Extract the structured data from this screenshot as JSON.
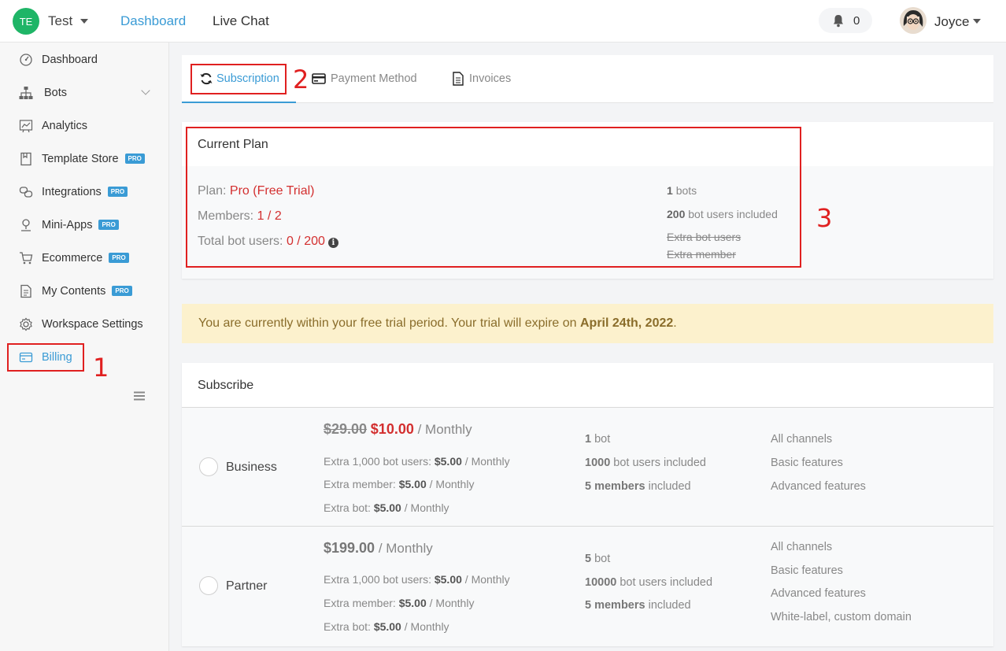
{
  "topbar": {
    "workspace_initials": "TE",
    "workspace_name": "Test",
    "nav": [
      "Dashboard",
      "Live Chat"
    ],
    "notification_count": "0",
    "user_name": "Joyce"
  },
  "sidebar": {
    "pro_badge": "PRO",
    "items": [
      {
        "label": "Dashboard"
      },
      {
        "label": "Bots"
      },
      {
        "label": "Analytics"
      },
      {
        "label": "Template Store"
      },
      {
        "label": "Integrations"
      },
      {
        "label": "Mini-Apps"
      },
      {
        "label": "Ecommerce"
      },
      {
        "label": "My Contents"
      },
      {
        "label": "Workspace Settings"
      },
      {
        "label": "Billing"
      }
    ]
  },
  "annotations": [
    "1",
    "2",
    "3"
  ],
  "tabs": [
    "Subscription",
    "Payment Method",
    "Invoices"
  ],
  "current_plan": {
    "title": "Current Plan",
    "plan_label": "Plan:",
    "plan_value": "Pro (Free Trial)",
    "members_label": "Members:",
    "members_value": "1 / 2",
    "users_label": "Total bot users:",
    "users_value": "0 / 200",
    "bots_count": "1",
    "bots_text": "bots",
    "users_included_count": "200",
    "users_included_text": "bot users included",
    "extra_bot_users": "Extra bot users",
    "extra_member": "Extra member"
  },
  "trial": {
    "text": "You are currently within your free trial period. Your trial will expire on",
    "date": "April 24th, 2022",
    "end": "."
  },
  "subscribe": {
    "title": "Subscribe",
    "plans": [
      {
        "name": "Business",
        "old_price": "$29.00",
        "new_price": "$10.00",
        "period": "/ Monthly",
        "extra_users_label": "Extra 1,000 bot users:",
        "extra_users_price": "$5.00",
        "extra_member_label": "Extra member:",
        "extra_member_price": "$5.00",
        "extra_bot_label": "Extra bot:",
        "extra_bot_price": "$5.00",
        "bots_count": "1",
        "bots_text": "bot",
        "users_count": "1000",
        "users_text": "bot users included",
        "members_count": "5 members",
        "members_text": "included",
        "features": [
          "All channels",
          "Basic features",
          "Advanced features"
        ]
      },
      {
        "name": "Partner",
        "price": "$199.00",
        "period": "/ Monthly",
        "extra_users_label": "Extra 1,000 bot users:",
        "extra_users_price": "$5.00",
        "extra_member_label": "Extra member:",
        "extra_member_price": "$5.00",
        "extra_bot_label": "Extra bot:",
        "extra_bot_price": "$5.00",
        "bots_count": "5",
        "bots_text": "bot",
        "users_count": "10000",
        "users_text": "bot users included",
        "members_count": "5 members",
        "members_text": "included",
        "features": [
          "All channels",
          "Basic features",
          "Advanced features",
          "White-label, custom domain"
        ]
      }
    ]
  }
}
